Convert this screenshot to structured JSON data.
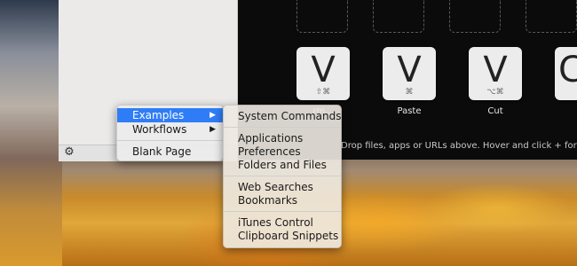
{
  "keys": [
    {
      "letter": "V",
      "modifiers": "⇧⌘",
      "label": "rm..."
    },
    {
      "letter": "V",
      "modifiers": "⌘",
      "label": "Paste"
    },
    {
      "letter": "V",
      "modifiers": "⌥⌘",
      "label": "Cut"
    },
    {
      "letter": "C",
      "modifiers": "",
      "label": ""
    }
  ],
  "hint_text": "Drop files, apps or URLs above. Hover and click + for more.",
  "main_menu": {
    "items": [
      {
        "label": "Examples",
        "arrow": "▶"
      },
      {
        "label": "Workflows",
        "arrow": "▶"
      },
      {
        "label": "Blank Page"
      }
    ]
  },
  "submenu": {
    "items": [
      "System Commands",
      "Applications",
      "Preferences",
      "Folders and Files",
      "Web Searches",
      "Bookmarks",
      "iTunes Control",
      "Clipboard Snippets"
    ]
  },
  "icons": {
    "gear": "⚙"
  }
}
